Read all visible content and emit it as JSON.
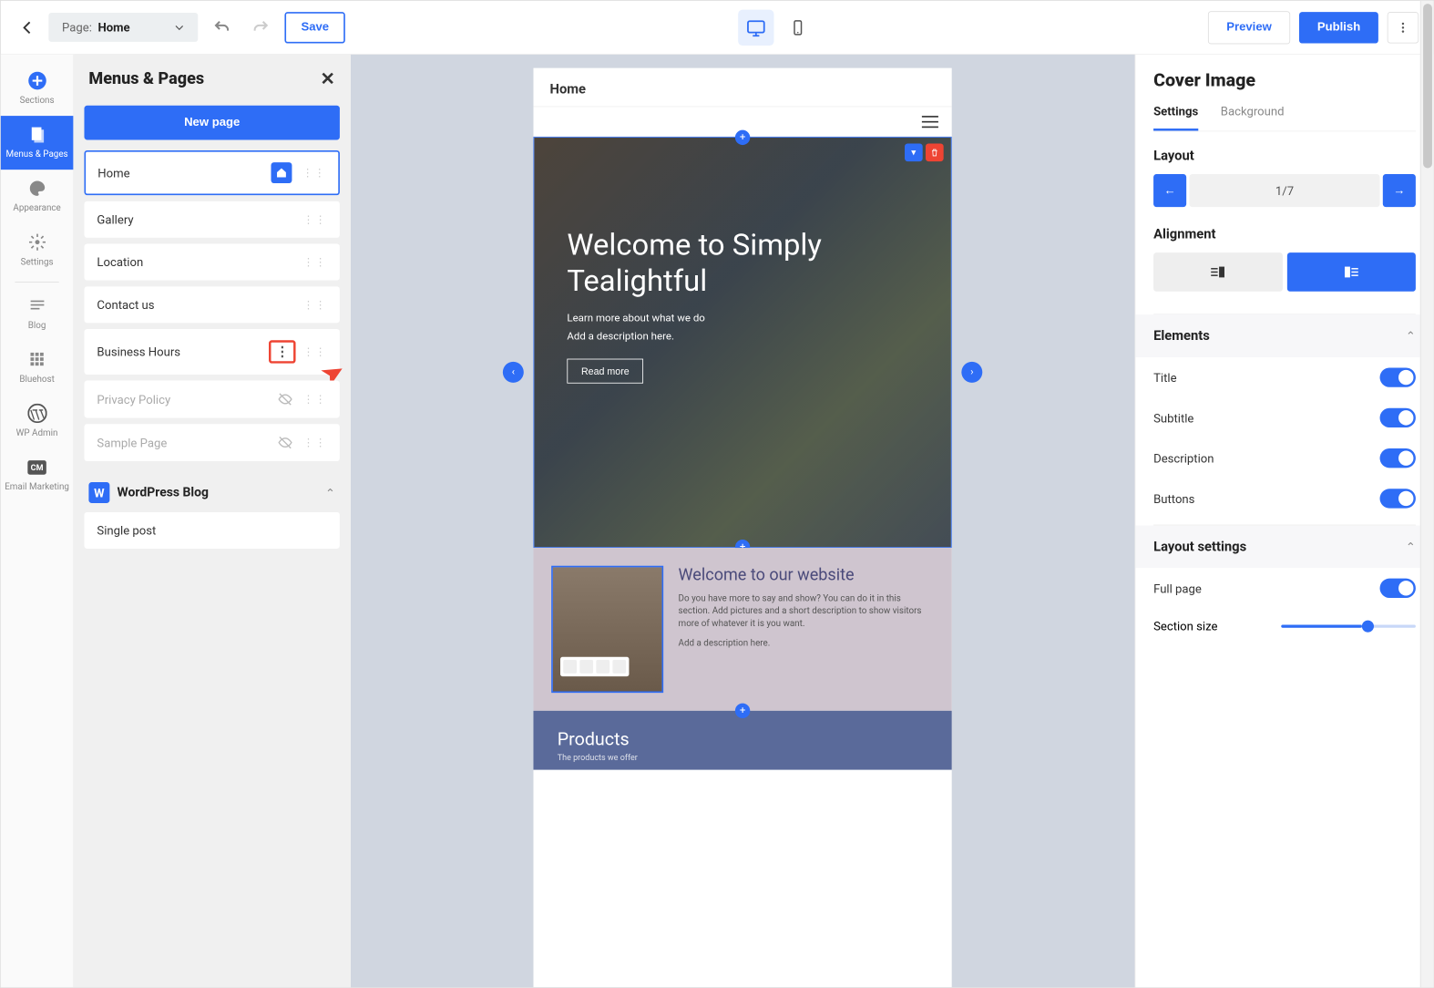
{
  "topbar": {
    "pageLabel": "Page:",
    "pageValue": "Home",
    "save": "Save",
    "preview": "Preview",
    "publish": "Publish"
  },
  "leftbar": {
    "items": [
      {
        "key": "sections",
        "label": "Sections",
        "icon": "plus"
      },
      {
        "key": "menus",
        "label": "Menus & Pages",
        "icon": "pages"
      },
      {
        "key": "appearance",
        "label": "Appearance",
        "icon": "palette"
      },
      {
        "key": "settings",
        "label": "Settings",
        "icon": "gear"
      },
      {
        "key": "blog",
        "label": "Blog",
        "icon": "blog"
      },
      {
        "key": "bluehost",
        "label": "Bluehost",
        "icon": "grid"
      },
      {
        "key": "wpadmin",
        "label": "WP Admin",
        "icon": "wp"
      },
      {
        "key": "email",
        "label": "Email Marketing",
        "icon": "cm"
      }
    ],
    "active": "menus"
  },
  "pagesPanel": {
    "title": "Menus & Pages",
    "newPage": "New page",
    "pages": [
      {
        "label": "Home",
        "selected": true,
        "home": true
      },
      {
        "label": "Gallery"
      },
      {
        "label": "Location"
      },
      {
        "label": "Contact us"
      },
      {
        "label": "Business Hours",
        "highlightDots": true
      },
      {
        "label": "Privacy Policy",
        "muted": true,
        "hidden": true
      },
      {
        "label": "Sample Page",
        "muted": true,
        "hidden": true
      }
    ],
    "wpSection": {
      "label": "WordPress Blog",
      "item": "Single post"
    }
  },
  "canvas": {
    "headerTitle": "Home",
    "hero": {
      "title": "Welcome to Simply Tealightful",
      "sub": "Learn more about what we do",
      "desc": "Add a description here.",
      "button": "Read more"
    },
    "welcome": {
      "title": "Welcome to our website",
      "body": "Do you have more to say and show? You can do it in this section. Add pictures and a short description to show visitors more of whatever it is you want.",
      "desc": "Add a description here."
    },
    "products": {
      "title": "Products",
      "sub": "The products we offer"
    }
  },
  "rightPanel": {
    "title": "Cover Image",
    "tabs": {
      "settings": "Settings",
      "background": "Background",
      "active": "settings"
    },
    "layout": {
      "label": "Layout",
      "value": "1/7"
    },
    "alignment": {
      "label": "Alignment"
    },
    "elements": {
      "label": "Elements",
      "items": [
        {
          "label": "Title",
          "on": true
        },
        {
          "label": "Subtitle",
          "on": true
        },
        {
          "label": "Description",
          "on": true
        },
        {
          "label": "Buttons",
          "on": true
        }
      ]
    },
    "layoutSettings": {
      "label": "Layout settings",
      "fullPage": "Full page",
      "sectionSize": "Section size"
    }
  }
}
